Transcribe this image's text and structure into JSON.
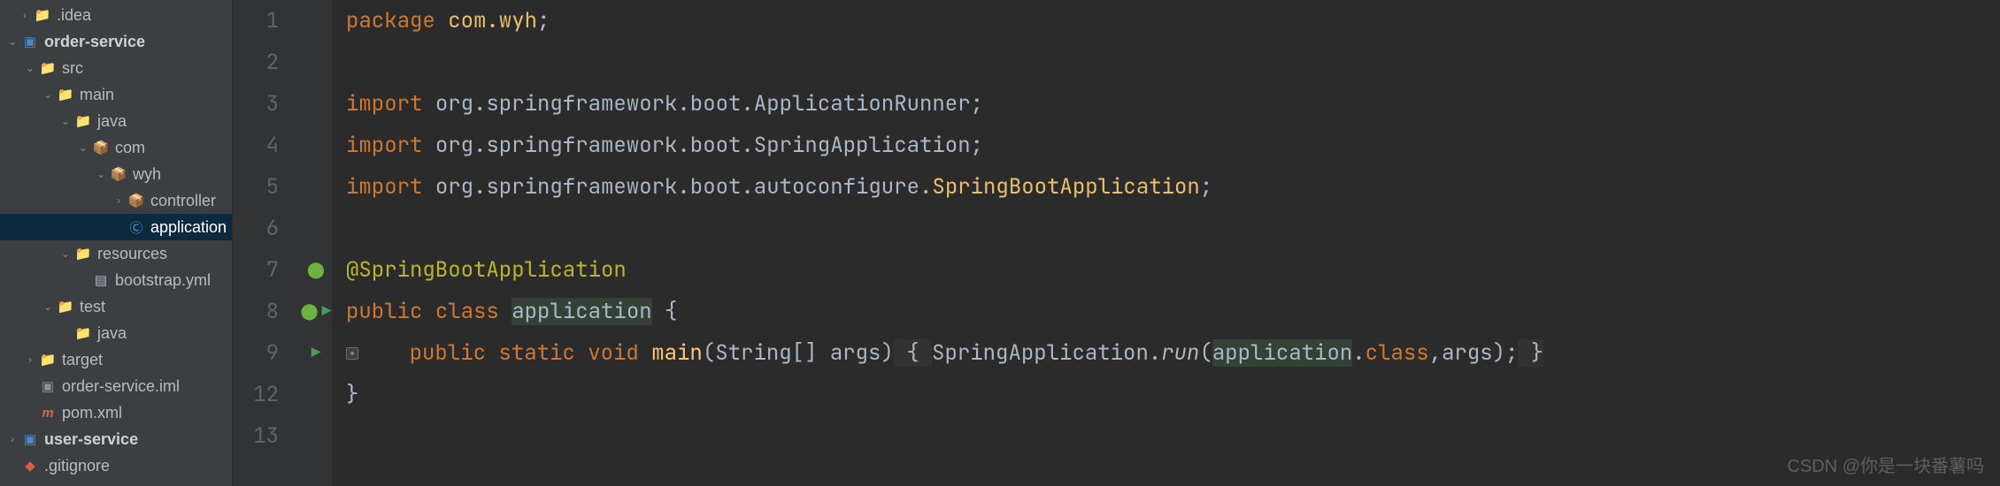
{
  "tree": {
    "idea": ".idea",
    "order_service": "order-service",
    "src": "src",
    "main": "main",
    "java": "java",
    "com": "com",
    "wyh": "wyh",
    "controller": "controller",
    "application": "application",
    "resources": "resources",
    "bootstrap": "bootstrap.yml",
    "test": "test",
    "java_test": "java",
    "target": "target",
    "iml": "order-service.iml",
    "pom": "pom.xml",
    "user_service": "user-service",
    "gitignore": ".gitignore"
  },
  "gutter": [
    "1",
    "2",
    "3",
    "4",
    "5",
    "6",
    "7",
    "8",
    "9",
    "12",
    "13"
  ],
  "code": {
    "line1": {
      "kw": "package ",
      "cls": "com.wyh",
      "end": ";"
    },
    "line3": {
      "kw": "import ",
      "pkg": "org.springframework.boot.ApplicationRunner;"
    },
    "line4": {
      "kw": "import ",
      "pkg": "org.springframework.boot.SpringApplication;"
    },
    "line5": {
      "kw": "import ",
      "pkg": "org.springframework.boot.autoconfigure.",
      "cls": "SpringBootApplication",
      "end": ";"
    },
    "line7": {
      "anno": "@SpringBootApplication"
    },
    "line8": {
      "kw1": "public ",
      "kw2": "class ",
      "name": "application",
      "brace": " {"
    },
    "line9": {
      "indent": "    ",
      "kw1": "public ",
      "kw2": "static ",
      "kw3": "void ",
      "meth": "main",
      "args": "(String[] args)",
      "brace1": " { ",
      "call": "SpringApplication.",
      "run": "run",
      "paren": "(",
      "appref": "application",
      "dot": ".",
      "classkw": "class",
      "rest": ",args);",
      "brace2": " }"
    },
    "line12": {
      "brace": "}"
    }
  },
  "watermark": "CSDN @你是一块番薯吗"
}
